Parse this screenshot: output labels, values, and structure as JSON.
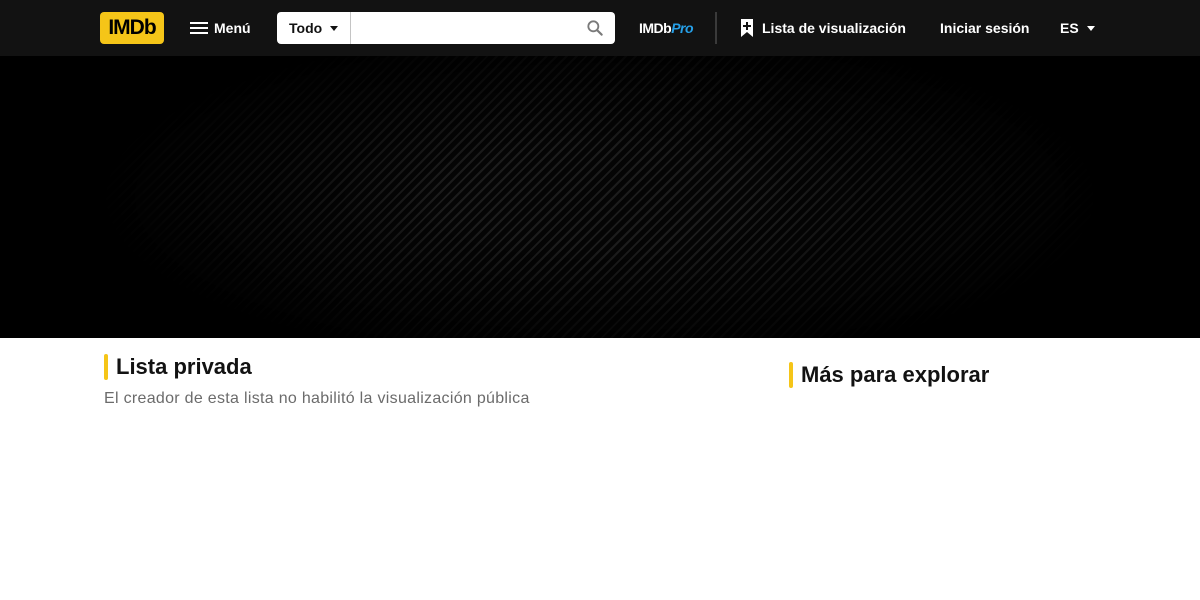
{
  "colors": {
    "brand": "#f5c518",
    "nav_background": "#121212",
    "pro_accent": "#26a0e8",
    "muted_text": "#6b6b6b"
  },
  "navbar": {
    "logo": "IMDb",
    "menu_label": "Menú",
    "search": {
      "category": "Todo",
      "value": "",
      "placeholder": "",
      "icon": "search-icon"
    },
    "pro_logo_part1": "IMDb",
    "pro_logo_part2": "Pro",
    "watchlist_label": "Lista de visualización",
    "watchlist_icon": "bookmark-plus-icon",
    "signin_label": "Iniciar sesión",
    "language": "ES"
  },
  "main": {
    "title": "Lista privada",
    "description": "El creador de esta lista no habilitó la visualización pública"
  },
  "sidebar": {
    "title": "Más para explorar"
  }
}
